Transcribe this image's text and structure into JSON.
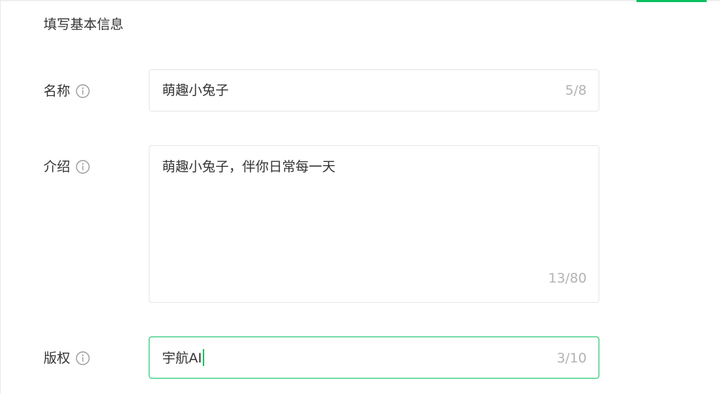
{
  "section_title": "填写基本信息",
  "accent_color": "#07c160",
  "fields": {
    "name": {
      "label": "名称",
      "value": "萌趣小兔子",
      "counter": "5/8",
      "icon": "info-icon"
    },
    "intro": {
      "label": "介绍",
      "value": "萌趣小兔子，伴你日常每一天",
      "counter": "13/80",
      "icon": "info-icon"
    },
    "copyright": {
      "label": "版权",
      "value": "宇航AI",
      "counter": "3/10",
      "icon": "info-icon",
      "focused": true
    }
  }
}
